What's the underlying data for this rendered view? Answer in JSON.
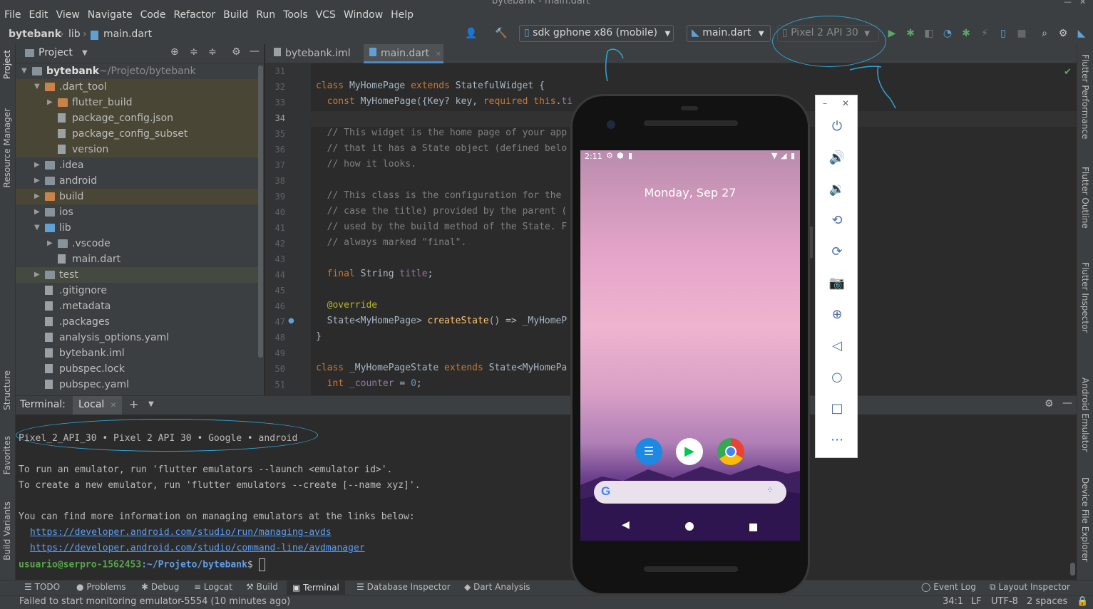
{
  "app": {
    "title": "bytebank - main.dart"
  },
  "menu": [
    "File",
    "Edit",
    "View",
    "Navigate",
    "Code",
    "Refactor",
    "Build",
    "Run",
    "Tools",
    "VCS",
    "Window",
    "Help"
  ],
  "breadcrumb": {
    "project": "bytebank",
    "folder": "lib",
    "file": "main.dart"
  },
  "toolbar": {
    "device": "sdk gphone x86 (mobile)",
    "run_config": "main.dart",
    "avd": "Pixel 2 API 30"
  },
  "project_panel": {
    "title": "Project",
    "root": {
      "name": "bytebank",
      "path": "~/Projeto/bytebank"
    },
    "items": [
      {
        "label": ".dart_tool",
        "indent": 1,
        "expanded": true,
        "icon": "folder-orange",
        "hl": "yellow"
      },
      {
        "label": "flutter_build",
        "indent": 2,
        "expanded": false,
        "icon": "folder-orange",
        "hl": "yellow"
      },
      {
        "label": "package_config.json",
        "indent": 2,
        "icon": "file",
        "hl": "yellow"
      },
      {
        "label": "package_config_subset",
        "indent": 2,
        "icon": "file",
        "hl": "yellow"
      },
      {
        "label": "version",
        "indent": 2,
        "icon": "file",
        "hl": "yellow"
      },
      {
        "label": ".idea",
        "indent": 1,
        "expanded": false,
        "icon": "folder"
      },
      {
        "label": "android",
        "indent": 1,
        "expanded": false,
        "icon": "folder"
      },
      {
        "label": "build",
        "indent": 1,
        "expanded": false,
        "icon": "folder-orange",
        "hl": "yellow"
      },
      {
        "label": "ios",
        "indent": 1,
        "expanded": false,
        "icon": "folder"
      },
      {
        "label": "lib",
        "indent": 1,
        "expanded": true,
        "icon": "folder-blue"
      },
      {
        "label": ".vscode",
        "indent": 2,
        "expanded": false,
        "icon": "folder"
      },
      {
        "label": "main.dart",
        "indent": 2,
        "icon": "file"
      },
      {
        "label": "test",
        "indent": 1,
        "expanded": false,
        "icon": "folder",
        "hl": "green"
      },
      {
        "label": ".gitignore",
        "indent": 1,
        "icon": "file"
      },
      {
        "label": ".metadata",
        "indent": 1,
        "icon": "file"
      },
      {
        "label": ".packages",
        "indent": 1,
        "icon": "file"
      },
      {
        "label": "analysis_options.yaml",
        "indent": 1,
        "icon": "file"
      },
      {
        "label": "bytebank.iml",
        "indent": 1,
        "icon": "file"
      },
      {
        "label": "pubspec.lock",
        "indent": 1,
        "icon": "file"
      },
      {
        "label": "pubspec.yaml",
        "indent": 1,
        "icon": "file"
      }
    ]
  },
  "left_stripe": [
    "Project",
    "Resource Manager",
    "Structure",
    "Favorites",
    "Build Variants"
  ],
  "right_stripe": [
    "Flutter Performance",
    "Flutter Outline",
    "Flutter Inspector",
    "Android Emulator",
    "Device File Explorer"
  ],
  "editor": {
    "tabs": [
      "bytebank.iml",
      "main.dart"
    ],
    "active_tab": 1,
    "line_numbers": [
      "31",
      "32",
      "33",
      "34",
      "35",
      "36",
      "37",
      "38",
      "39",
      "40",
      "41",
      "42",
      "43",
      "44",
      "45",
      "46",
      "47",
      "48",
      "49",
      "50",
      "51"
    ]
  },
  "terminal": {
    "label": "Terminal:",
    "tab": "Local",
    "lines": [
      "Pixel_2_API_30 • Pixel 2 API 30 • Google • android",
      "To run an emulator, run 'flutter emulators --launch <emulator id>'.",
      "To create a new emulator, run 'flutter emulators --create [--name xyz]'.",
      "You can find more information on managing emulators at the links below:"
    ],
    "links": [
      "https://developer.android.com/studio/run/managing-avds",
      "https://developer.android.com/studio/command-line/avdmanager"
    ],
    "prompt_user": "usuario@serpro-1562453",
    "prompt_path": ":~/Projeto/bytebank",
    "prompt_symbol": "$"
  },
  "bottom_tools": [
    "TODO",
    "Problems",
    "Debug",
    "Logcat",
    "Build",
    "Terminal",
    "Database Inspector",
    "Dart Analysis"
  ],
  "bottom_right_tools": [
    "Event Log",
    "Layout Inspector"
  ],
  "status": {
    "message": "Failed to start monitoring emulator-5554 (10 minutes ago)",
    "position": "34:1",
    "line_sep": "LF",
    "encoding": "UTF-8",
    "indent": "2 spaces"
  },
  "emulator": {
    "time": "2:11",
    "date": "Monday, Sep 27"
  }
}
